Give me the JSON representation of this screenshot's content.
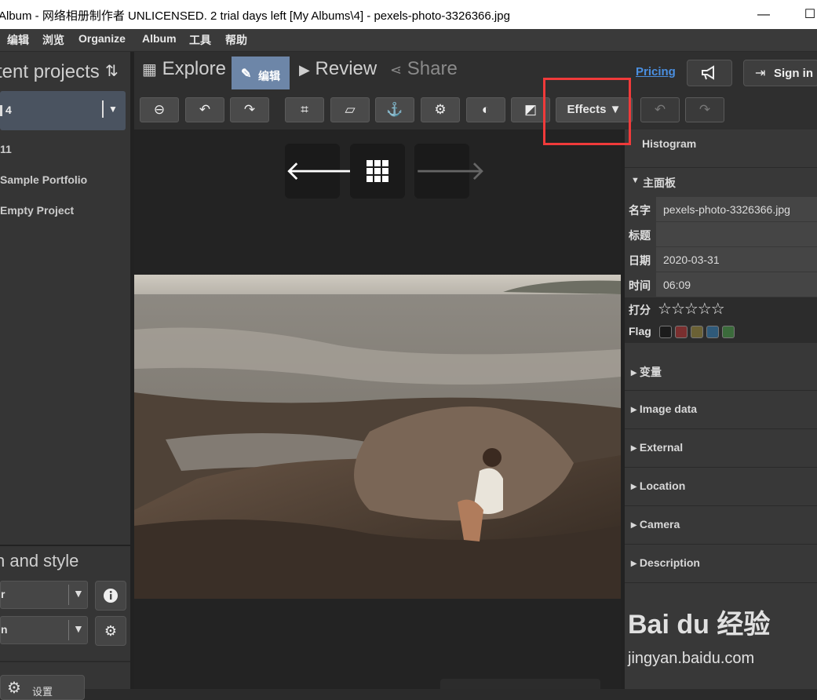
{
  "window": {
    "title": "Album - 网络相册制作者 UNLICENSED. 2 trial days left [My Albums\\4] - pexels-photo-3326366.jpg",
    "minimize_glyph": "—",
    "maximize_glyph": "☐"
  },
  "menu": {
    "items": [
      "编辑",
      "浏览",
      "Organize",
      "Album",
      "工具",
      "帮助"
    ]
  },
  "left_panel": {
    "title": "tent projects",
    "selected_project": "4",
    "projects": [
      "11",
      "Sample Portfolio",
      "Empty Project"
    ],
    "style_title": "n and style",
    "combo1_value": "r",
    "combo2_value": "n",
    "settings_label": "设置"
  },
  "top_nav": {
    "tabs": {
      "explore": "Explore",
      "edit": "编辑",
      "review": "Review",
      "share": "Share"
    },
    "pricing": "Pricing",
    "sign_in": "Sign in"
  },
  "toolbar": {
    "effects_label": "Effects"
  },
  "right_panel": {
    "histogram": "Histogram",
    "main_panel": "主面板",
    "fields": [
      {
        "key": "名字",
        "value": "pexels-photo-3326366.jpg"
      },
      {
        "key": "标题",
        "value": ""
      },
      {
        "key": "日期",
        "value": "2020-03-31"
      },
      {
        "key": "时间",
        "value": "06:09"
      }
    ],
    "rating_label": "打分",
    "rating": 0,
    "rating_max": 5,
    "flag_label": "Flag",
    "flag_colors": [
      "#1c1c1c",
      "#7a2f2f",
      "#6b6135",
      "#2f5a7a",
      "#3b6b3b"
    ],
    "sections": [
      "变量",
      "Image data",
      "External",
      "Location",
      "Camera",
      "Description"
    ]
  },
  "watermark": {
    "brand": "Bai du 经验",
    "url": "jingyan.baidu.com"
  }
}
